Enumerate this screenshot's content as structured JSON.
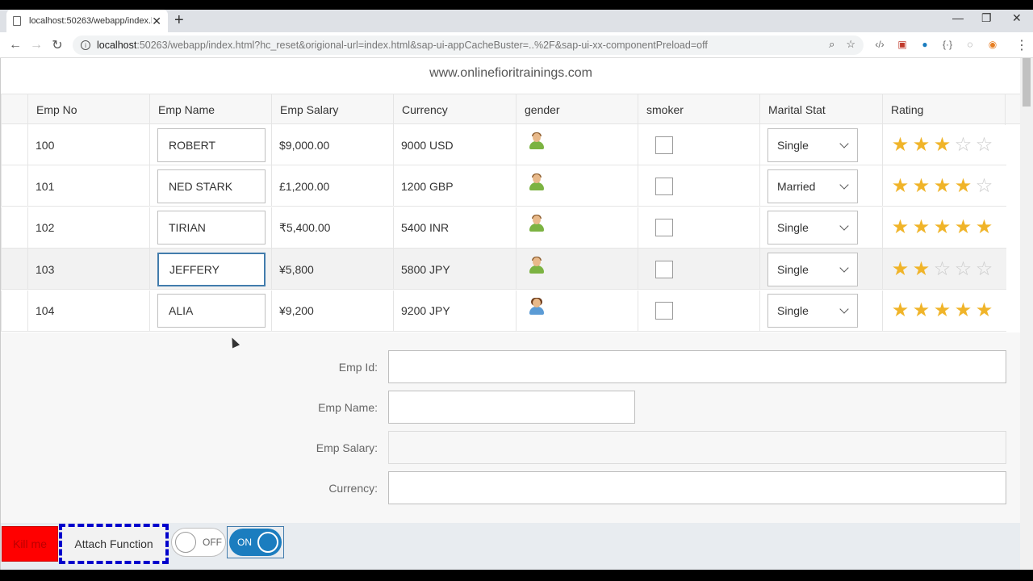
{
  "browser": {
    "tab_title": "localhost:50263/webapp/index.h",
    "url_host": "localhost",
    "url_rest": ":50263/webapp/index.html?hc_reset&origional-url=index.html&sap-ui-appCacheBuster=..%2F&sap-ui-xx-componentPreload=off"
  },
  "app": {
    "site_title": "www.onlinefioritrainings.com"
  },
  "table": {
    "columns": [
      "Emp No",
      "Emp Name",
      "Emp Salary",
      "Currency",
      "gender",
      "smoker",
      "Marital Stat",
      "Rating"
    ],
    "rows": [
      {
        "no": "100",
        "name": "ROBERT",
        "salary": "$9,000.00",
        "currency": "9000 USD",
        "gender": "male",
        "smoker": false,
        "marital": "Single",
        "rating": 3
      },
      {
        "no": "101",
        "name": "NED STARK",
        "salary": "£1,200.00",
        "currency": "1200 GBP",
        "gender": "male",
        "smoker": false,
        "marital": "Married",
        "rating": 4
      },
      {
        "no": "102",
        "name": "TIRIAN",
        "salary": "₹5,400.00",
        "currency": "5400 INR",
        "gender": "male",
        "smoker": false,
        "marital": "Single",
        "rating": 5
      },
      {
        "no": "103",
        "name": "JEFFERY",
        "salary": "¥5,800",
        "currency": "5800 JPY",
        "gender": "male",
        "smoker": false,
        "marital": "Single",
        "rating": 2
      },
      {
        "no": "104",
        "name": "ALIA",
        "salary": "¥9,200",
        "currency": "9200 JPY",
        "gender": "female",
        "smoker": false,
        "marital": "Single",
        "rating": 5
      }
    ]
  },
  "form": {
    "emp_id_label": "Emp Id:",
    "emp_name_label": "Emp Name:",
    "emp_salary_label": "Emp Salary:",
    "currency_label": "Currency:"
  },
  "footer": {
    "kill_label": "Kill me",
    "attach_label": "Attach Function",
    "switch_off_label": "OFF",
    "switch_on_label": "ON"
  },
  "colors": {
    "kill_button": "#ff0000",
    "attach_border": "#0000cc",
    "switch_on": "#1b7dbf",
    "star": "#f0b429"
  }
}
